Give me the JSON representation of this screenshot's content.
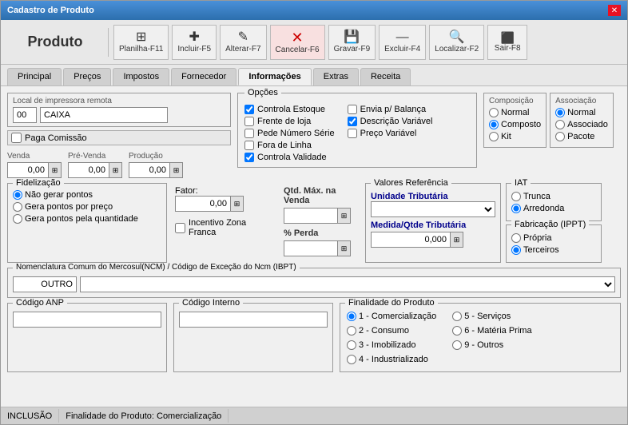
{
  "window": {
    "title": "Cadastro de Produto"
  },
  "app_title": "Produto",
  "toolbar": {
    "buttons": [
      {
        "id": "planilha",
        "icon": "⊞",
        "label": "Planilha-F11"
      },
      {
        "id": "incluir",
        "icon": "＋",
        "label": "Incluir-F5"
      },
      {
        "id": "alterar",
        "icon": "✎",
        "label": "Alterar-F7"
      },
      {
        "id": "cancelar",
        "icon": "✕",
        "label": "Cancelar-F6",
        "style": "cancel"
      },
      {
        "id": "gravar",
        "icon": "💾",
        "label": "Gravar-F9"
      },
      {
        "id": "excluir",
        "icon": "—",
        "label": "Excluir-F4"
      },
      {
        "id": "localizar",
        "icon": "🔍",
        "label": "Localizar-F2"
      },
      {
        "id": "sair",
        "icon": "⬡",
        "label": "Sair-F8"
      }
    ]
  },
  "tabs": [
    "Principal",
    "Preços",
    "Impostos",
    "Fornecedor",
    "Informações",
    "Extras",
    "Receita"
  ],
  "active_tab": "Informações",
  "local_impressora": {
    "label": "Local de impressora remota",
    "id_value": "00",
    "name_value": "CAIXA"
  },
  "paga_comissao": {
    "label": "Paga Comissão",
    "checked": false
  },
  "venda": {
    "label": "Venda",
    "value": "0,00"
  },
  "pre_venda": {
    "label": "Pré-Venda",
    "value": "0,00"
  },
  "producao": {
    "label": "Produção",
    "value": "0,00"
  },
  "opcoes": {
    "title": "Opções",
    "col1": [
      {
        "id": "controla_estoque",
        "label": "Controla Estoque",
        "checked": true
      },
      {
        "id": "frente_loja",
        "label": "Frente de loja",
        "checked": false
      },
      {
        "id": "pede_numero_serie",
        "label": "Pede Número Série",
        "checked": false
      },
      {
        "id": "fora_linha",
        "label": "Fora de Linha",
        "checked": false
      },
      {
        "id": "controla_validade",
        "label": "Controla Validade",
        "checked": true
      }
    ],
    "col2": [
      {
        "id": "envia_balanca",
        "label": "Envia p/ Balança",
        "checked": false
      },
      {
        "id": "descricao_variavel",
        "label": "Descrição Variável",
        "checked": true
      },
      {
        "id": "preco_variavel",
        "label": "Preço Variável",
        "checked": false
      }
    ]
  },
  "composicao": {
    "title": "Composição",
    "options": [
      "Normal",
      "Composto",
      "Kit"
    ],
    "selected": "Composto"
  },
  "associacao": {
    "title": "Associação",
    "options": [
      "Normal",
      "Associado",
      "Pacote"
    ],
    "selected": "Normal"
  },
  "fidelizacao": {
    "title": "Fidelização",
    "options": [
      {
        "id": "nao_gerar",
        "label": "Não gerar pontos",
        "checked": true
      },
      {
        "id": "pontos_preco",
        "label": "Gera pontos por preço",
        "checked": false
      },
      {
        "id": "pontos_qtde",
        "label": "Gera pontos pela quantidade",
        "checked": false
      }
    ]
  },
  "fator": {
    "label": "Fator:",
    "value": "0,00"
  },
  "incentivo_zona_franca": {
    "label": "Incentivo Zona Franca",
    "checked": false
  },
  "qtd_max_venda": {
    "label": "Qtd. Máx. na Venda",
    "value": ""
  },
  "perda": {
    "label": "% Perda",
    "value": ""
  },
  "valores_referencia": {
    "title": "Valores Referência",
    "unidade_tributaria": {
      "label": "Unidade Tributária",
      "value": ""
    },
    "medida_qtde": {
      "label": "Medida/Qtde Tributária",
      "value": "0,000"
    }
  },
  "iat": {
    "title": "IAT",
    "options": [
      "Trunca",
      "Arredonda"
    ],
    "selected": "Arredonda"
  },
  "fabricacao": {
    "title": "Fabricação (IPPT)",
    "options": [
      "Própria",
      "Terceiros"
    ],
    "selected": "Terceiros"
  },
  "ncm": {
    "title": "Nomenclatura Comum do Mercosul(NCM) / Código de Exceção do Ncm (IBPT)",
    "value": "OUTRO"
  },
  "codigo_anp": {
    "title": "Código ANP",
    "value": ""
  },
  "codigo_interno": {
    "title": "Código Interno",
    "value": ""
  },
  "finalidade": {
    "title": "Finalidade do Produto",
    "col1": [
      {
        "id": "comercializacao",
        "label": "1 - Comercialização",
        "checked": true
      },
      {
        "id": "consumo",
        "label": "2 - Consumo",
        "checked": false
      },
      {
        "id": "imobilizado",
        "label": "3 - Imobilizado",
        "checked": false
      },
      {
        "id": "industrializado",
        "label": "4 - Industrializado",
        "checked": false
      }
    ],
    "col2": [
      {
        "id": "servicos",
        "label": "5 - Serviços",
        "checked": false
      },
      {
        "id": "materia_prima",
        "label": "6 - Matéria Prima",
        "checked": false
      },
      {
        "id": "outros",
        "label": "9 - Outros",
        "checked": false
      }
    ]
  },
  "status_bar": {
    "mode": "INCLUSÃO",
    "finalidade": "Finalidade do Produto: Comercialização"
  }
}
